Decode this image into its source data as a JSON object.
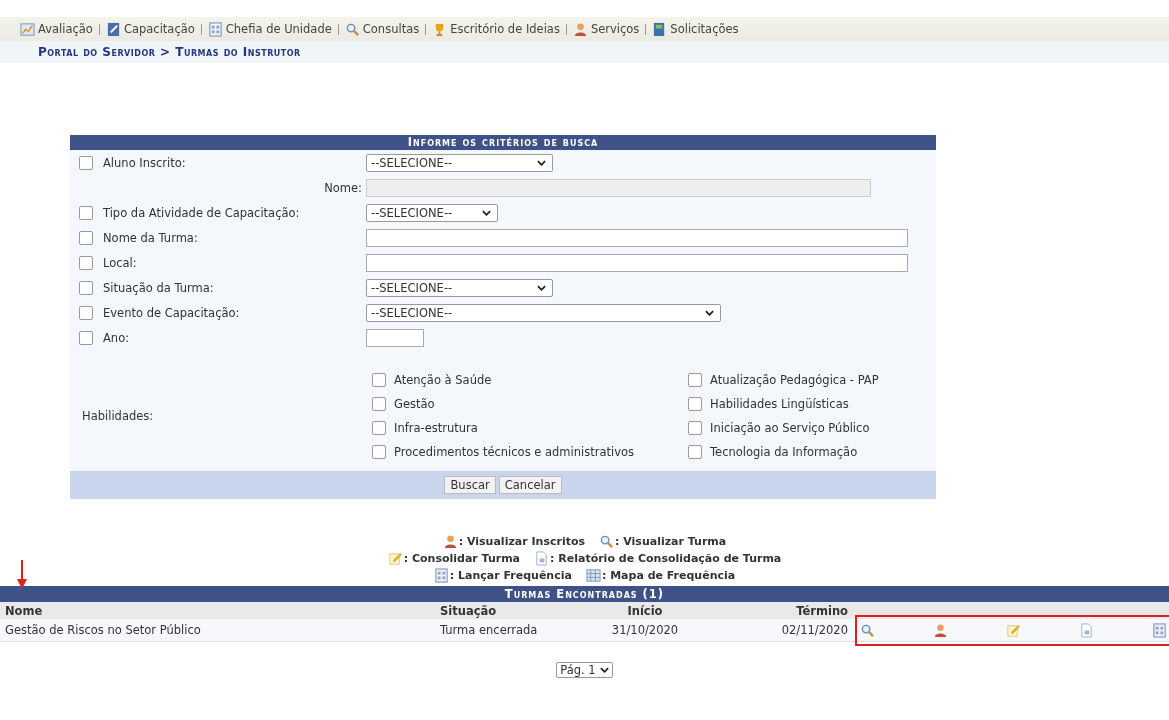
{
  "menu": [
    {
      "label": "Avaliação",
      "kind": "chart"
    },
    {
      "label": "Capacitação",
      "kind": "notepad"
    },
    {
      "label": "Chefia de Unidade",
      "kind": "calendar"
    },
    {
      "label": "Consultas",
      "kind": "search"
    },
    {
      "label": "Escritório de Ideias",
      "kind": "trophy"
    },
    {
      "label": "Serviços",
      "kind": "person"
    },
    {
      "label": "Solicitações",
      "kind": "book"
    }
  ],
  "breadcrumb": "Portal do Servidor > Turmas do Instrutor",
  "form": {
    "title": "Informe os critérios de busca",
    "rows": [
      {
        "kind": "select",
        "label": "Aluno Inscrito:",
        "checked": false,
        "value": "--SELECIONE--"
      },
      {
        "kind": "subfield",
        "label": "Nome:",
        "disabled": true
      },
      {
        "kind": "select",
        "label": "Tipo da Atividade de Capacitação:",
        "checked": false,
        "value": "--SELECIONE--"
      },
      {
        "kind": "text",
        "label": "Nome da Turma:",
        "checked": false
      },
      {
        "kind": "text",
        "label": "Local:",
        "checked": false
      },
      {
        "kind": "select",
        "label": "Situação da Turma:",
        "checked": false,
        "value": "--SELECIONE--"
      },
      {
        "kind": "select",
        "label": "Evento de Capacitação:",
        "checked": false,
        "value": "--SELECIONE--"
      },
      {
        "kind": "text",
        "label": "Ano:",
        "checked": false
      }
    ],
    "skills_label": "Habilidades:",
    "skills": [
      {
        "label": "Atenção à Saúde",
        "checked": false
      },
      {
        "label": "Atualização Pedagógica - PAP",
        "checked": false
      },
      {
        "label": "Gestão",
        "checked": false
      },
      {
        "label": "Habilidades Lingüísticas",
        "checked": false
      },
      {
        "label": "Infra-estrutura",
        "checked": false
      },
      {
        "label": "Iniciação ao Serviço Público",
        "checked": false
      },
      {
        "label": "Procedimentos técnicos e administrativos",
        "checked": false
      },
      {
        "label": "Tecnologia da Informação",
        "checked": false
      }
    ],
    "buttons": [
      "Buscar",
      "Cancelar"
    ]
  },
  "legend": [
    [
      {
        "kind": "person",
        "label": ": Visualizar Inscritos"
      },
      {
        "kind": "search",
        "label": ": Visualizar Turma"
      }
    ],
    [
      {
        "kind": "pencil",
        "label": ": Consolidar Turma"
      },
      {
        "kind": "report",
        "label": ": Relatório de Consolidação de Turma"
      }
    ],
    [
      {
        "kind": "calendar",
        "label": ": Lançar Frequência"
      },
      {
        "kind": "grid",
        "label": ": Mapa de Frequência"
      }
    ]
  ],
  "results": {
    "title": "Turmas Encontradas (1)",
    "columns": [
      "Nome",
      "Situação",
      "Início",
      "Término"
    ],
    "rows": [
      {
        "cells": [
          "Gestão de Riscos no Setor Público",
          "Turma encerrada",
          "31/10/2020",
          "02/11/2020"
        ]
      }
    ]
  },
  "pagination": "Pág. 1"
}
